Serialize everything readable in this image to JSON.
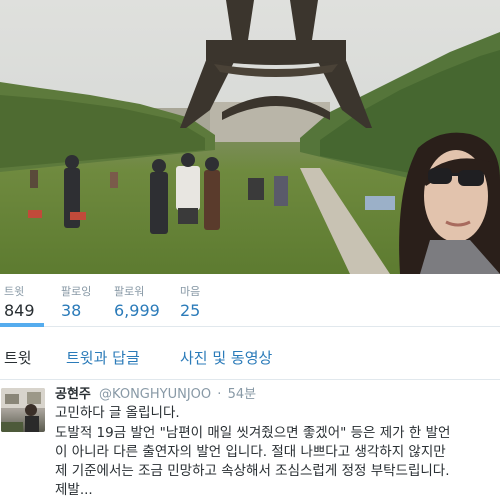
{
  "header": {
    "photo_alt": ""
  },
  "stats": {
    "items": [
      {
        "label": "트윗",
        "value": "849"
      },
      {
        "label": "팔로잉",
        "value": "38"
      },
      {
        "label": "팔로워",
        "value": "6,999"
      },
      {
        "label": "마음",
        "value": "25"
      }
    ]
  },
  "tabs": {
    "items": [
      {
        "label": "트윗"
      },
      {
        "label": "트윗과 답글"
      },
      {
        "label": "사진 및 동영상"
      }
    ]
  },
  "tweet": {
    "name": "공현주",
    "handle": "@KONGHYUNJOO",
    "dot": "·",
    "time": "54분",
    "lines": [
      "고민하다 글 올립니다.",
      "도발적 19금 발언 \"남편이 매일 씻겨줬으면 좋겠어\" 등은 제가 한 발언",
      "이 아니라 다른 출연자의 발언 입니다. 절대 나쁘다고 생각하지 않지만",
      "제 기준에서는 조금 민망하고 속상해서 조심스럽게 정정 부탁드립니다.",
      "제발..."
    ]
  },
  "colors": {
    "link_blue": "#2b7bb9",
    "accent_blue": "#55acee",
    "muted_gray": "#8899a6",
    "text_dark": "#292f33"
  }
}
